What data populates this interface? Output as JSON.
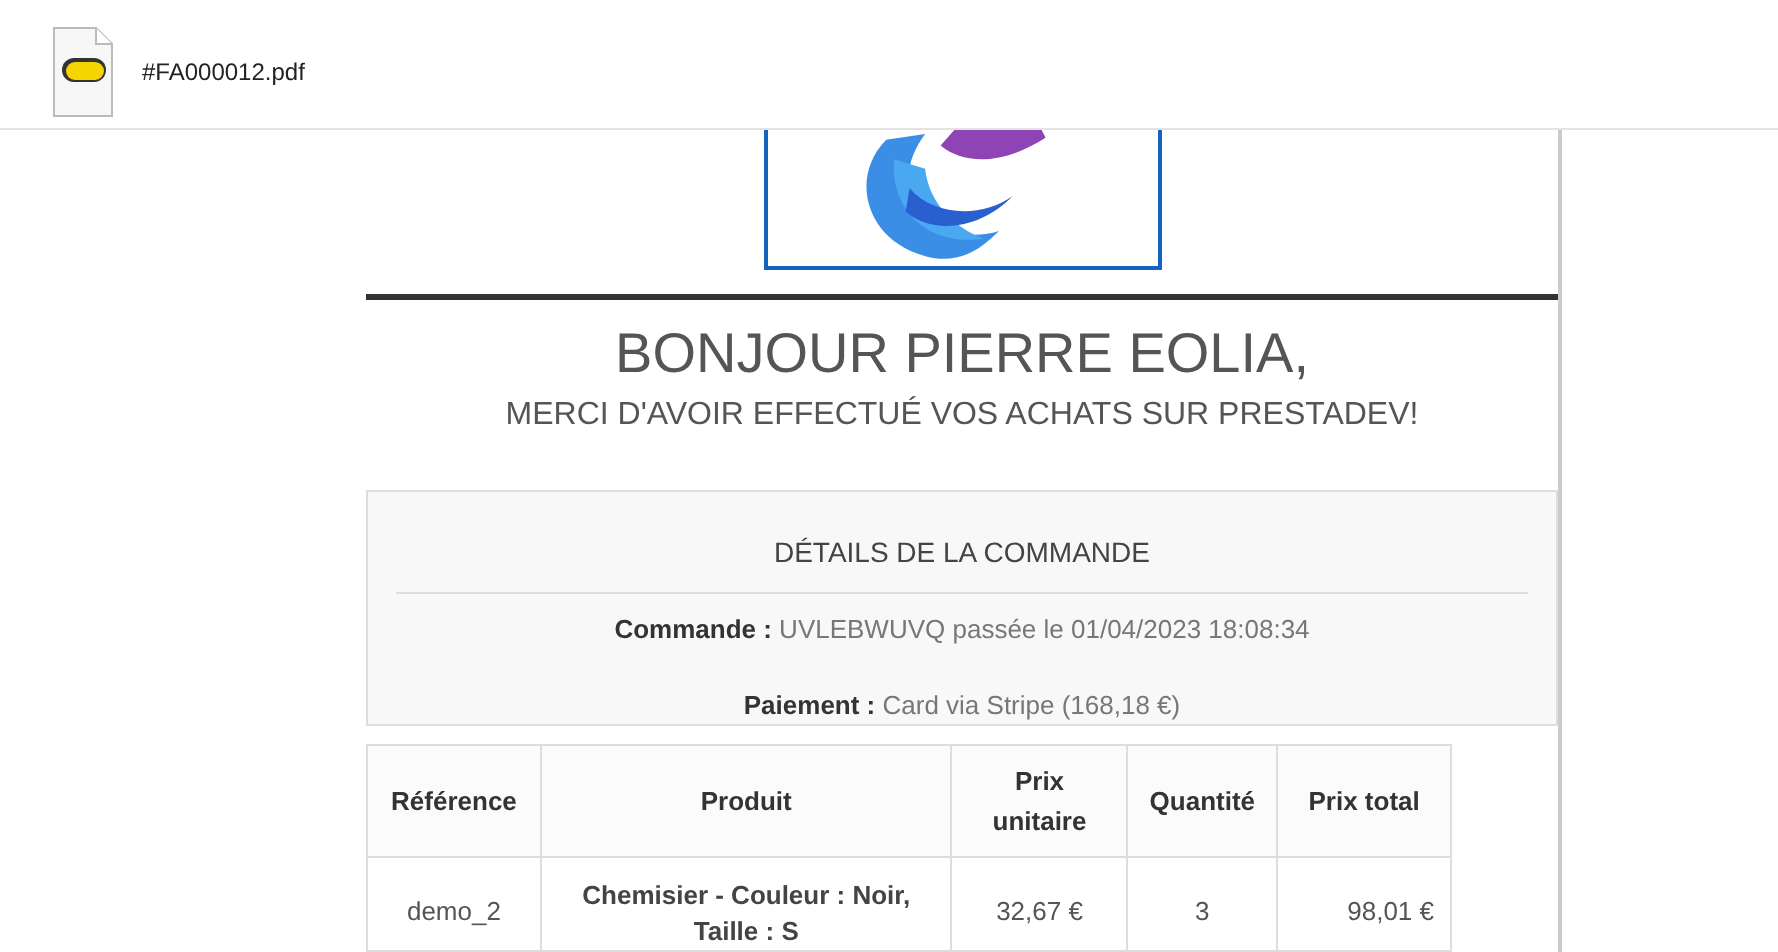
{
  "attachment": {
    "filename": "#FA000012.pdf"
  },
  "greeting": {
    "title": "BONJOUR PIERRE EOLIA,",
    "subtitle": "MERCI D'AVOIR EFFECTUÉ VOS ACHATS SUR PRESTADEV!"
  },
  "order_details": {
    "heading": "DÉTAILS DE LA COMMANDE",
    "lines": [
      {
        "label": "Commande :",
        "value": "UVLEBWUVQ passée le 01/04/2023 18:08:34"
      },
      {
        "label": "Paiement :",
        "value": "Card via Stripe (168,18 €)"
      }
    ]
  },
  "table": {
    "columns": [
      "Référence",
      "Produit",
      "Prix unitaire",
      "Quantité",
      "Prix total"
    ],
    "rows": [
      [
        "demo_2",
        "Chemisier - Couleur : Noir, Taille : S",
        "32,67 €",
        "3",
        "98,01 €"
      ]
    ]
  }
}
